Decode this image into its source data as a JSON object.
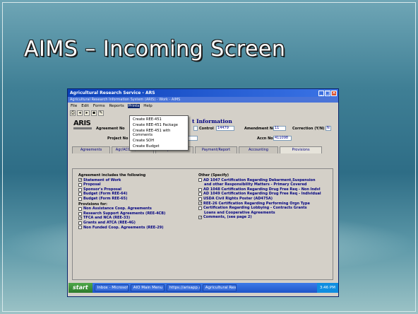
{
  "slide": {
    "title": "AIMS – Incoming Screen"
  },
  "window": {
    "title": "Agricultural Research Service - ARS",
    "subtitle": "Agricultural Research Information System (ARIS) - Work - AIMS"
  },
  "menu": [
    "File",
    "Edit",
    "Forms",
    "Reports",
    "Prints",
    "Help"
  ],
  "prints_menu": [
    "Create REE-451",
    "Create REE-451 Package",
    "Create REE-451 with Comments",
    "Create SOH",
    "Create Budget"
  ],
  "header": {
    "logo": "ARIS",
    "info_title": "t Information",
    "agreement_no_label": "Agreement No",
    "control_label": "Control",
    "control_value": "14479",
    "amendment_label": "Amendment No",
    "amendment_value": "11",
    "correction_label": "Correction (Y/N)",
    "correction_value": "N",
    "project_no_label": "Project No",
    "accn_label": "Accn No",
    "accn_value": "411098"
  },
  "tabs": [
    "Agreements",
    "Agr/ACCOP/Finance",
    "Cooperator Info",
    "Payment/Report",
    "Accounting",
    "Provisions"
  ],
  "provisions": {
    "left_heading": "Agreement includes the following",
    "left_items": [
      {
        "label": "Statement of Work",
        "checked": true
      },
      {
        "label": "Proposal",
        "checked": false
      },
      {
        "label": "Sponsor's Proposal",
        "checked": false
      },
      {
        "label": "Budget (Form REE-64)",
        "checked": false
      },
      {
        "label": "Budget (Form REE-65)",
        "checked": false
      }
    ],
    "provisions_heading": "Provisions for:",
    "provision_items": [
      {
        "label": "Non Assistance Coop. Agreements",
        "checked": false
      },
      {
        "label": "Research Support Agreements (REE-4CB)",
        "checked": false
      },
      {
        "label": "TFCA and NCA (REE-33)",
        "checked": true
      },
      {
        "label": "Grants and ATCA (REE-4G)",
        "checked": false
      },
      {
        "label": "Non Funded Coop. Agreements (REE-29)",
        "checked": false
      }
    ],
    "right_heading": "Other (Specify)",
    "right_items": [
      {
        "label": "AD 1047 Certification Regarding Debarment,Suspension",
        "checked": false
      },
      {
        "label": "and other Responsibility Matters - Primary Covered",
        "checked": false,
        "continuation": true
      },
      {
        "label": "AD 1048 Certification Regarding Drug Free Req - Non Indvl",
        "checked": false
      },
      {
        "label": "AD 1049 Certification Regarding Drug Free Req - Individual",
        "checked": false
      },
      {
        "label": "USDA Civil Rights Poster (AD475A)",
        "checked": false
      },
      {
        "label": "REE-26 Certification Regarding Performing Orgn Type",
        "checked": true
      },
      {
        "label": "Certification Regarding Lobbying - Contracts Grants",
        "checked": false
      },
      {
        "label": "Loans and Cooperative Agreements",
        "checked": false,
        "continuation": true
      },
      {
        "label": "Comments, (see page 2)",
        "checked": true
      }
    ]
  },
  "taskbar": {
    "start": "start",
    "buttons": [
      "Inbox - Microsoft ...",
      "AIO Main Menu -...",
      "https://arisapp.ar...",
      "Agricultural Resea..."
    ],
    "clock": "3:46 PM"
  }
}
